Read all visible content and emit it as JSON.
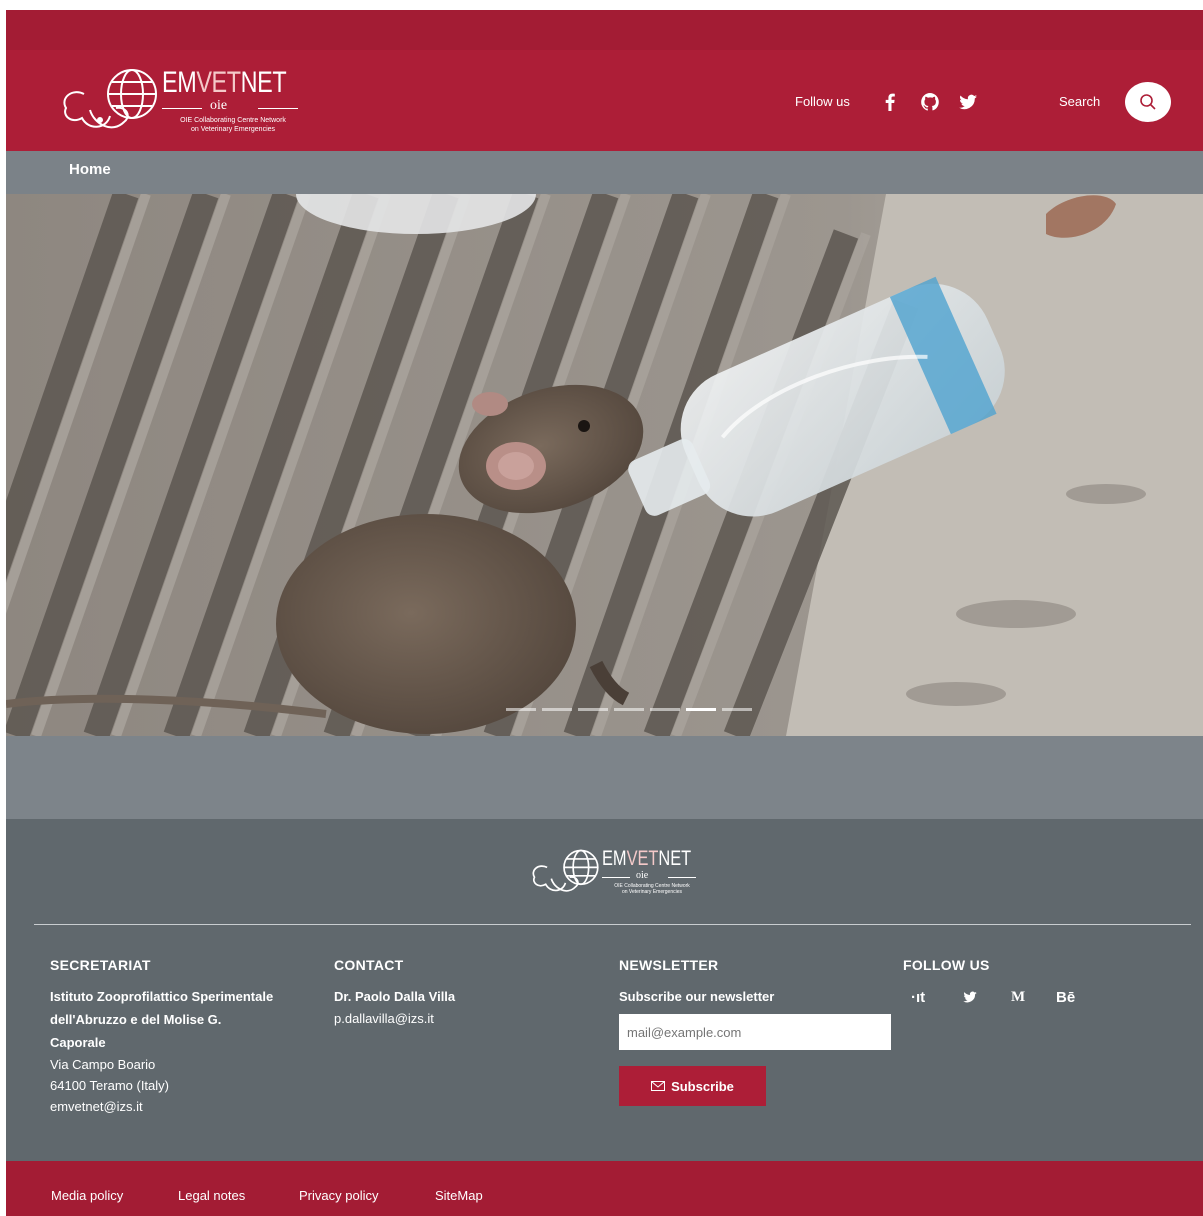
{
  "header": {
    "brand": {
      "em": "EM",
      "vet": "VET",
      "net": "NET"
    },
    "oie": "oie",
    "tagline_1": "OIE Collaborating Centre Network",
    "tagline_2": "on Veterinary Emergencies",
    "follow_label": "Follow us",
    "social_icons": [
      "facebook-icon",
      "github-icon",
      "twitter-icon"
    ],
    "search_label": "Search"
  },
  "breadcrumb": {
    "home": "Home"
  },
  "hero": {
    "slides_count": 7,
    "active_slide": 6
  },
  "footer": {
    "secretariat": {
      "title": "SECRETARIAT",
      "org_line1": "Istituto Zooprofilattico Sperimentale",
      "org_line2": "dell'Abruzzo e del Molise G.",
      "org_line3": "Caporale",
      "address1": "Via Campo Boario",
      "address2": "64100 Teramo (Italy)",
      "email": "emvetnet@izs.it"
    },
    "contact": {
      "title": "CONTACT",
      "name": "Dr. Paolo Dalla Villa",
      "email": "p.dallavilla@izs.it"
    },
    "newsletter": {
      "title": "NEWSLETTER",
      "subtitle": "Subscribe our newsletter",
      "placeholder": "mail@example.com",
      "button": "Subscribe"
    },
    "follow": {
      "title": "FOLLOW US",
      "items": [
        "·ıt",
        "",
        "M",
        "Bē"
      ]
    }
  },
  "bottom_links": [
    "Media policy",
    "Legal notes",
    "Privacy policy",
    "SiteMap"
  ],
  "colors": {
    "brand_red": "#ad1e37",
    "footer_gray": "#60686d",
    "crumb_gray": "#7b8288"
  }
}
